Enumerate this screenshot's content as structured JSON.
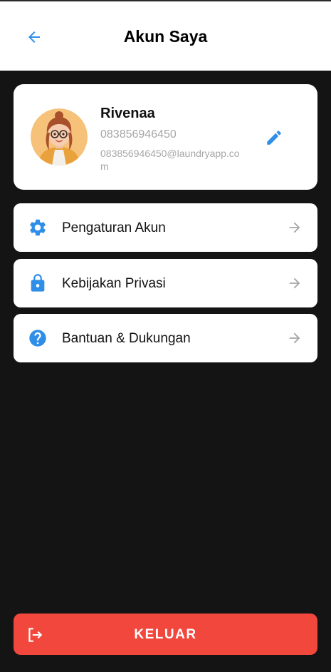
{
  "header": {
    "title": "Akun Saya",
    "back_icon": "arrow-left-icon"
  },
  "profile": {
    "name": "Rivenaa",
    "phone": "083856946450",
    "email": "083856946450@laundryapp.com",
    "avatar_icon": "avatar-illustration",
    "edit_icon": "pencil-icon"
  },
  "menu": {
    "items": [
      {
        "label": "Pengaturan Akun",
        "icon": "gear-icon"
      },
      {
        "label": "Kebijakan Privasi",
        "icon": "lock-icon"
      },
      {
        "label": "Bantuan & Dukungan",
        "icon": "help-circle-icon"
      }
    ]
  },
  "logout": {
    "label": "KELUAR",
    "icon": "logout-icon"
  },
  "colors": {
    "accent": "#2f8ee8",
    "danger": "#f2473c",
    "background": "#141414",
    "muted_text": "#a6a6a6"
  }
}
